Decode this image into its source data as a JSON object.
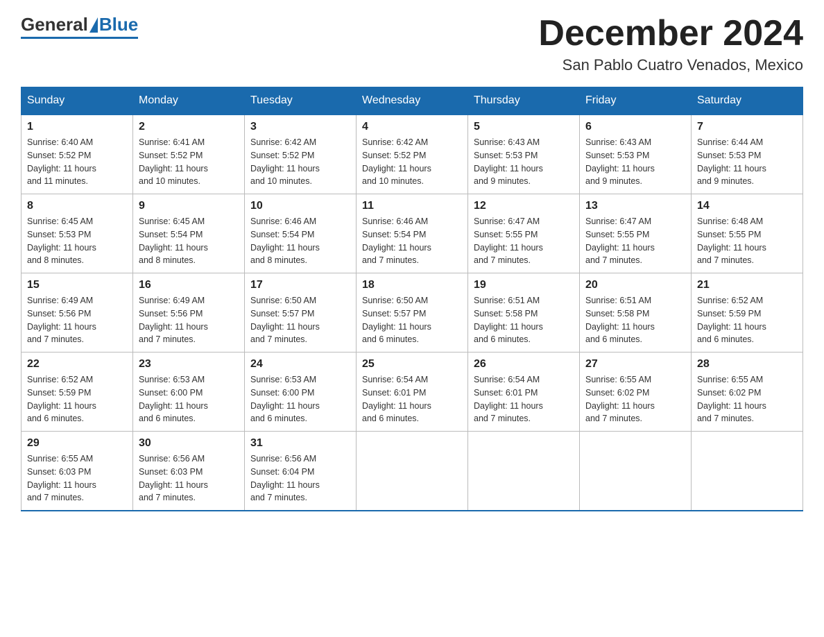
{
  "logo": {
    "general": "General",
    "blue": "Blue"
  },
  "header": {
    "month": "December 2024",
    "location": "San Pablo Cuatro Venados, Mexico"
  },
  "days": [
    "Sunday",
    "Monday",
    "Tuesday",
    "Wednesday",
    "Thursday",
    "Friday",
    "Saturday"
  ],
  "weeks": [
    [
      {
        "num": "1",
        "sunrise": "6:40 AM",
        "sunset": "5:52 PM",
        "daylight": "11 hours and 11 minutes."
      },
      {
        "num": "2",
        "sunrise": "6:41 AM",
        "sunset": "5:52 PM",
        "daylight": "11 hours and 10 minutes."
      },
      {
        "num": "3",
        "sunrise": "6:42 AM",
        "sunset": "5:52 PM",
        "daylight": "11 hours and 10 minutes."
      },
      {
        "num": "4",
        "sunrise": "6:42 AM",
        "sunset": "5:52 PM",
        "daylight": "11 hours and 10 minutes."
      },
      {
        "num": "5",
        "sunrise": "6:43 AM",
        "sunset": "5:53 PM",
        "daylight": "11 hours and 9 minutes."
      },
      {
        "num": "6",
        "sunrise": "6:43 AM",
        "sunset": "5:53 PM",
        "daylight": "11 hours and 9 minutes."
      },
      {
        "num": "7",
        "sunrise": "6:44 AM",
        "sunset": "5:53 PM",
        "daylight": "11 hours and 9 minutes."
      }
    ],
    [
      {
        "num": "8",
        "sunrise": "6:45 AM",
        "sunset": "5:53 PM",
        "daylight": "11 hours and 8 minutes."
      },
      {
        "num": "9",
        "sunrise": "6:45 AM",
        "sunset": "5:54 PM",
        "daylight": "11 hours and 8 minutes."
      },
      {
        "num": "10",
        "sunrise": "6:46 AM",
        "sunset": "5:54 PM",
        "daylight": "11 hours and 8 minutes."
      },
      {
        "num": "11",
        "sunrise": "6:46 AM",
        "sunset": "5:54 PM",
        "daylight": "11 hours and 7 minutes."
      },
      {
        "num": "12",
        "sunrise": "6:47 AM",
        "sunset": "5:55 PM",
        "daylight": "11 hours and 7 minutes."
      },
      {
        "num": "13",
        "sunrise": "6:47 AM",
        "sunset": "5:55 PM",
        "daylight": "11 hours and 7 minutes."
      },
      {
        "num": "14",
        "sunrise": "6:48 AM",
        "sunset": "5:55 PM",
        "daylight": "11 hours and 7 minutes."
      }
    ],
    [
      {
        "num": "15",
        "sunrise": "6:49 AM",
        "sunset": "5:56 PM",
        "daylight": "11 hours and 7 minutes."
      },
      {
        "num": "16",
        "sunrise": "6:49 AM",
        "sunset": "5:56 PM",
        "daylight": "11 hours and 7 minutes."
      },
      {
        "num": "17",
        "sunrise": "6:50 AM",
        "sunset": "5:57 PM",
        "daylight": "11 hours and 7 minutes."
      },
      {
        "num": "18",
        "sunrise": "6:50 AM",
        "sunset": "5:57 PM",
        "daylight": "11 hours and 6 minutes."
      },
      {
        "num": "19",
        "sunrise": "6:51 AM",
        "sunset": "5:58 PM",
        "daylight": "11 hours and 6 minutes."
      },
      {
        "num": "20",
        "sunrise": "6:51 AM",
        "sunset": "5:58 PM",
        "daylight": "11 hours and 6 minutes."
      },
      {
        "num": "21",
        "sunrise": "6:52 AM",
        "sunset": "5:59 PM",
        "daylight": "11 hours and 6 minutes."
      }
    ],
    [
      {
        "num": "22",
        "sunrise": "6:52 AM",
        "sunset": "5:59 PM",
        "daylight": "11 hours and 6 minutes."
      },
      {
        "num": "23",
        "sunrise": "6:53 AM",
        "sunset": "6:00 PM",
        "daylight": "11 hours and 6 minutes."
      },
      {
        "num": "24",
        "sunrise": "6:53 AM",
        "sunset": "6:00 PM",
        "daylight": "11 hours and 6 minutes."
      },
      {
        "num": "25",
        "sunrise": "6:54 AM",
        "sunset": "6:01 PM",
        "daylight": "11 hours and 6 minutes."
      },
      {
        "num": "26",
        "sunrise": "6:54 AM",
        "sunset": "6:01 PM",
        "daylight": "11 hours and 7 minutes."
      },
      {
        "num": "27",
        "sunrise": "6:55 AM",
        "sunset": "6:02 PM",
        "daylight": "11 hours and 7 minutes."
      },
      {
        "num": "28",
        "sunrise": "6:55 AM",
        "sunset": "6:02 PM",
        "daylight": "11 hours and 7 minutes."
      }
    ],
    [
      {
        "num": "29",
        "sunrise": "6:55 AM",
        "sunset": "6:03 PM",
        "daylight": "11 hours and 7 minutes."
      },
      {
        "num": "30",
        "sunrise": "6:56 AM",
        "sunset": "6:03 PM",
        "daylight": "11 hours and 7 minutes."
      },
      {
        "num": "31",
        "sunrise": "6:56 AM",
        "sunset": "6:04 PM",
        "daylight": "11 hours and 7 minutes."
      },
      null,
      null,
      null,
      null
    ]
  ],
  "labels": {
    "sunrise": "Sunrise:",
    "sunset": "Sunset:",
    "daylight": "Daylight:"
  }
}
